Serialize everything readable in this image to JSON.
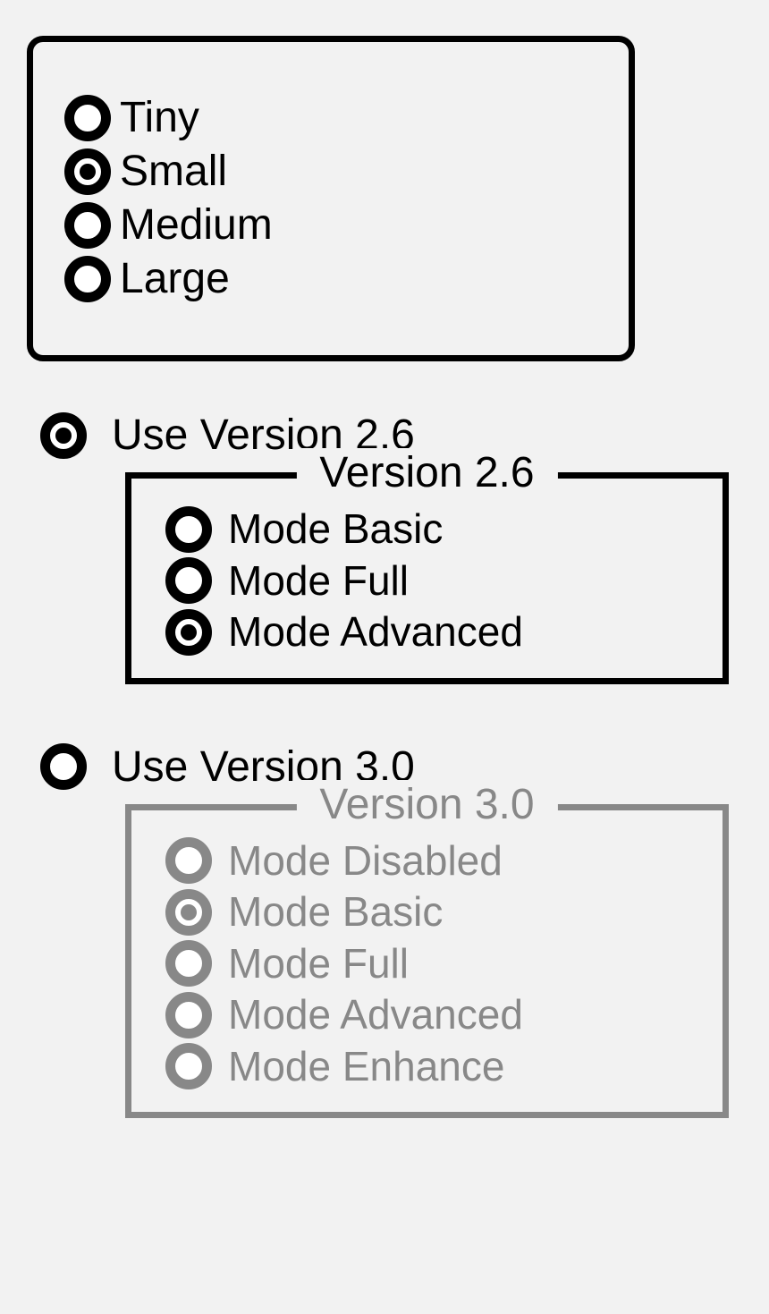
{
  "size_group": {
    "options": [
      {
        "label": "Tiny",
        "selected": false
      },
      {
        "label": "Small",
        "selected": true
      },
      {
        "label": "Medium",
        "selected": false
      },
      {
        "label": "Large",
        "selected": false
      }
    ]
  },
  "version_select": {
    "options": [
      {
        "label": "Use Version 2.6",
        "selected": true
      },
      {
        "label": "Use Version 3.0",
        "selected": false
      }
    ]
  },
  "v26": {
    "legend": "Version 2.6",
    "enabled": true,
    "options": [
      {
        "label": "Mode Basic",
        "selected": false
      },
      {
        "label": "Mode Full",
        "selected": false
      },
      {
        "label": "Mode Advanced",
        "selected": true
      }
    ]
  },
  "v30": {
    "legend": "Version 3.0",
    "enabled": false,
    "options": [
      {
        "label": "Mode Disabled",
        "selected": false
      },
      {
        "label": "Mode Basic",
        "selected": true
      },
      {
        "label": "Mode Full",
        "selected": false
      },
      {
        "label": "Mode Advanced",
        "selected": false
      },
      {
        "label": "Mode Enhance",
        "selected": false
      }
    ]
  }
}
